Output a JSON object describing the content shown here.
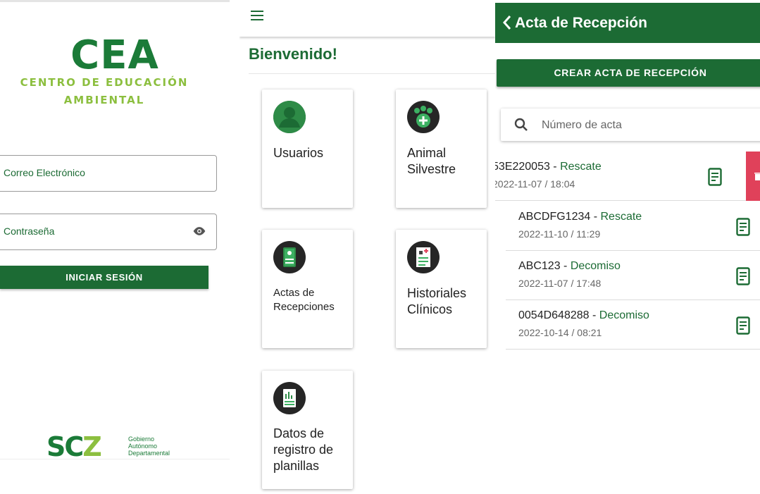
{
  "login": {
    "logo_main": "CEA",
    "logo_line1": "CENTRO DE EDUCACIÓN",
    "logo_line2": "AMBIENTAL",
    "email_label": "Correo Electrónico",
    "password_label": "Contraseña",
    "login_button": "INICIAR SESIÓN",
    "footer_logo": {
      "letters": "SC",
      "letter_z": "Z",
      "line1": "Gobierno",
      "line2": "Autónomo",
      "line3": "Departamental"
    }
  },
  "home": {
    "welcome": "Bienvenido!",
    "cards": [
      {
        "label": "Usuarios",
        "icon": "users-icon"
      },
      {
        "label": "Animal Silvestre",
        "icon": "paw-plus-icon"
      },
      {
        "label": "Actas de Recepciones",
        "icon": "book-icon"
      },
      {
        "label": "Historiales Clínicos",
        "icon": "medical-record-icon"
      },
      {
        "label": "Datos de registro de planillas",
        "icon": "report-chart-icon"
      }
    ]
  },
  "acta": {
    "title": "Acta de Recepción",
    "create_button": "CREAR ACTA DE RECEPCIÓN",
    "search_placeholder": "Número de acta",
    "items": [
      {
        "code": "53E220053",
        "type": "Rescate",
        "datetime": "2022-11-07 / 18:04"
      },
      {
        "code": "ABCDFG1234",
        "type": "Rescate",
        "datetime": "2022-11-10 / 11:29"
      },
      {
        "code": "ABC123",
        "type": "Decomiso",
        "datetime": "2022-11-07 / 17:48"
      },
      {
        "code": "0054D648288",
        "type": "Decomiso",
        "datetime": "2022-10-14 / 08:21"
      }
    ],
    "item_separator": " - "
  },
  "colors": {
    "primary": "#1c6b34",
    "accent": "#8cbf3f",
    "delete": "#e0415a"
  }
}
